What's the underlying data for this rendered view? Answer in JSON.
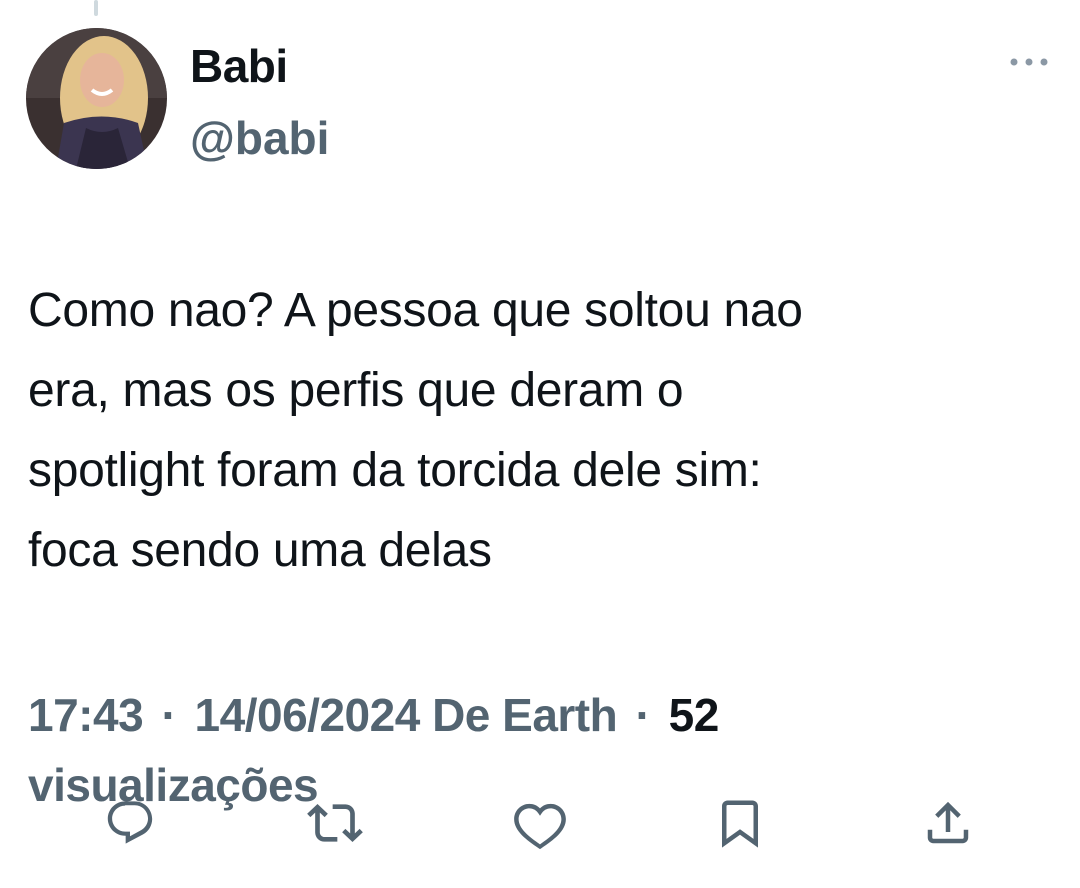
{
  "tweet": {
    "author": {
      "display_name": "Babi",
      "handle": "@babi"
    },
    "text_lines": [
      "Como nao? A pessoa que soltou nao",
      "era, mas os perfis que deram o",
      "spotlight foram da torcida dele sim:",
      "foca sendo uma delas"
    ],
    "meta": {
      "time": "17:43",
      "date": "14/06/2024",
      "source": "De Earth",
      "separator": "·",
      "views_count": "52",
      "views_label": "visualizações"
    }
  },
  "icons": {
    "more": "more-dots-icon",
    "reply": "reply-icon",
    "retweet": "retweet-icon",
    "like": "heart-icon",
    "bookmark": "bookmark-icon",
    "share": "share-icon"
  },
  "colors": {
    "text_primary": "#0f1419",
    "text_secondary": "#536471",
    "background": "#ffffff"
  }
}
